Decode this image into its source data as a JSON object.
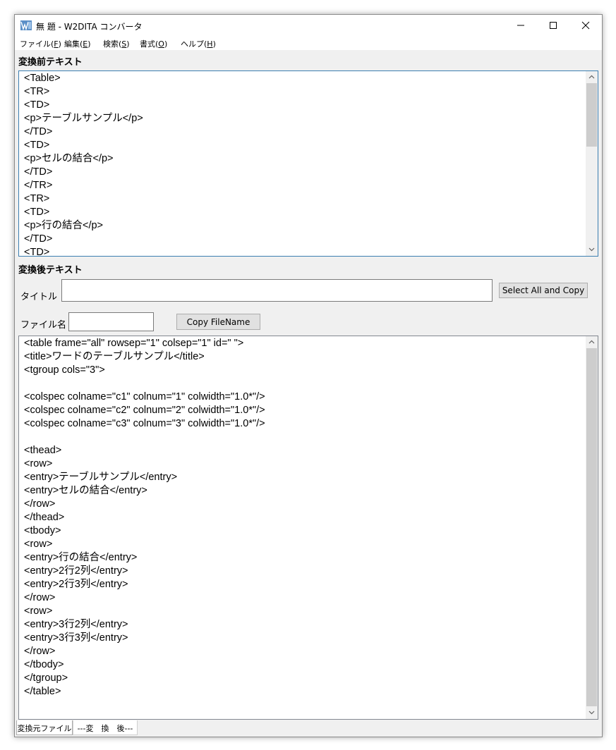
{
  "window": {
    "title": "無 題 - W2DITA コンバータ",
    "accent_color": "#3c7fb1"
  },
  "menu": {
    "items": [
      {
        "label": "ファイル(",
        "key": "F",
        "close": ")"
      },
      {
        "label": "編集(",
        "key": "E",
        "close": ")"
      },
      {
        "label": "検索(",
        "key": "S",
        "close": ")"
      },
      {
        "label": "書式(",
        "key": "O",
        "close": ")"
      },
      {
        "label": "ヘルプ(",
        "key": "H",
        "close": ")"
      }
    ]
  },
  "before": {
    "label": "変換前テキスト",
    "text": "<Table>\n<TR>\n<TD>\n<p>テーブルサンプル</p>\n</TD>\n<TD>\n<p>セルの結合</p>\n</TD>\n</TR>\n<TR>\n<TD>\n<p>行の結合</p>\n</TD>\n<TD>"
  },
  "after": {
    "label": "変換後テキスト",
    "title_label": "タイトル",
    "title_value": "",
    "select_copy_label": "Select All and Copy",
    "filename_label": "ファイル名",
    "filename_value": "",
    "copy_filename_label": "Copy FileName",
    "text": "<table frame=\"all\" rowsep=\"1\" colsep=\"1\" id=\" \">\n<title>ワードのテーブルサンプル</title>\n<tgroup cols=\"3\">\n\n<colspec colname=\"c1\" colnum=\"1\" colwidth=\"1.0*\"/>\n<colspec colname=\"c2\" colnum=\"2\" colwidth=\"1.0*\"/>\n<colspec colname=\"c3\" colnum=\"3\" colwidth=\"1.0*\"/>\n\n<thead>\n<row>\n<entry>テーブルサンプル</entry>\n<entry>セルの結合</entry>\n</row>\n</thead>\n<tbody>\n<row>\n<entry>行の結合</entry>\n<entry>2行2列</entry>\n<entry>2行3列</entry>\n</row>\n<row>\n<entry>3行2列</entry>\n<entry>3行3列</entry>\n</row>\n</tbody>\n</tgroup>\n</table>"
  },
  "tabs": [
    {
      "label": "変換元ファイル",
      "selected": true
    },
    {
      "label": "---変　換　後---",
      "selected": false
    }
  ]
}
